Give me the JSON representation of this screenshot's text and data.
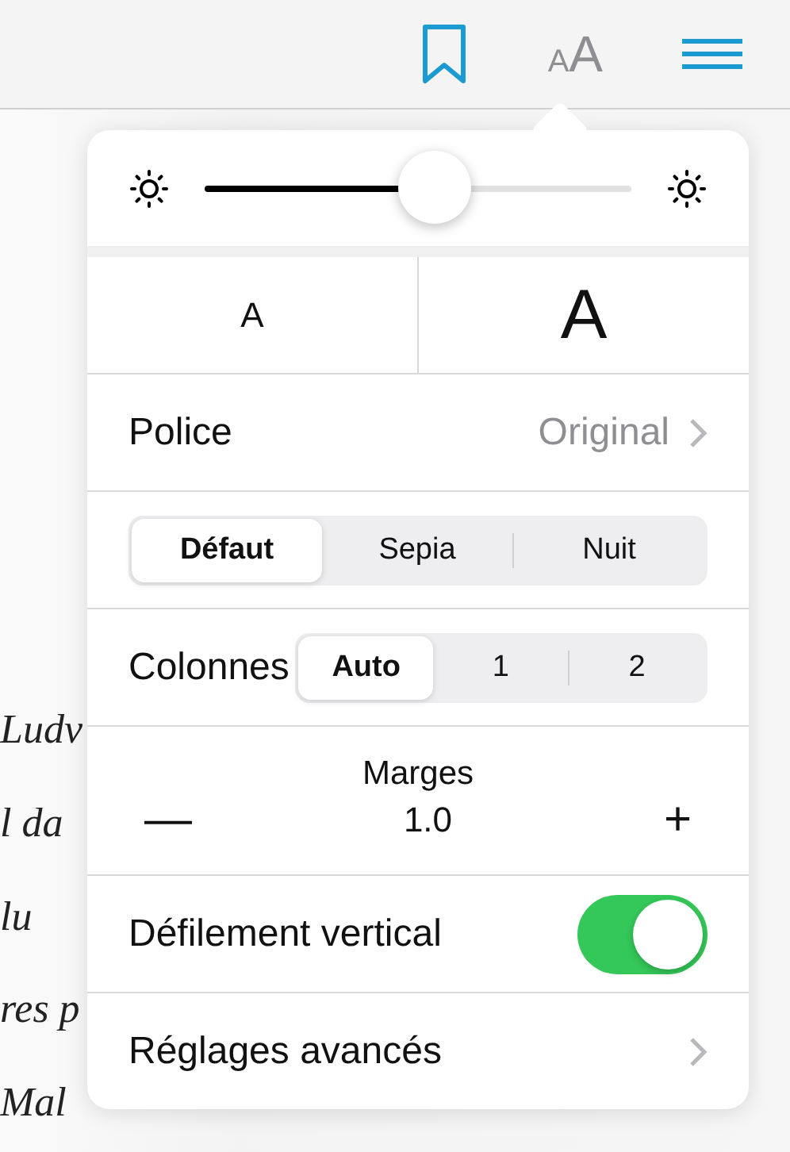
{
  "toolbar": {
    "font_button": {
      "small": "A",
      "large": "A"
    }
  },
  "page_text": [
    "Ludv",
    "l da",
    "lu",
    "res p",
    "Mal"
  ],
  "brightness": {
    "level": 0.54
  },
  "font_size": {
    "smaller": "A",
    "larger": "A"
  },
  "font": {
    "label": "Police",
    "value": "Original"
  },
  "themes": [
    {
      "label": "Défaut",
      "selected": true
    },
    {
      "label": "Sepia",
      "selected": false
    },
    {
      "label": "Nuit",
      "selected": false
    }
  ],
  "columns": {
    "label": "Colonnes",
    "options": [
      {
        "label": "Auto",
        "selected": true
      },
      {
        "label": "1",
        "selected": false
      },
      {
        "label": "2",
        "selected": false
      }
    ]
  },
  "margins": {
    "label": "Marges",
    "minus": "—",
    "value": "1.0",
    "plus": "+"
  },
  "vertical_scroll": {
    "label": "Défilement vertical",
    "on": true
  },
  "advanced": {
    "label": "Réglages avancés"
  }
}
